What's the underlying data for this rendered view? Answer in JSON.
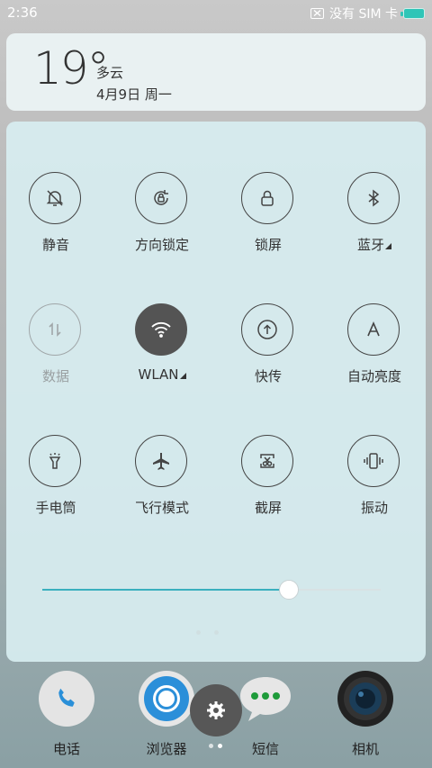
{
  "status_bar": {
    "time": "2:36",
    "sim_text": "没有 SIM 卡"
  },
  "weather": {
    "temp": "19°",
    "condition": "多云",
    "date": "4月9日 周一"
  },
  "toggles": [
    {
      "label": "静音",
      "icon": "bell-off-icon",
      "state": "off-outline"
    },
    {
      "label": "方向锁定",
      "icon": "rotation-lock-icon",
      "state": "off-outline"
    },
    {
      "label": "锁屏",
      "icon": "lock-icon",
      "state": "off-outline"
    },
    {
      "label": "蓝牙",
      "icon": "bluetooth-icon",
      "state": "off-outline",
      "expandable": true
    },
    {
      "label": "数据",
      "icon": "mobile-data-icon",
      "state": "disabled"
    },
    {
      "label": "WLAN",
      "icon": "wifi-icon",
      "state": "on",
      "expandable": true
    },
    {
      "label": "快传",
      "icon": "quick-share-icon",
      "state": "off-outline"
    },
    {
      "label": "自动亮度",
      "icon": "auto-brightness-icon",
      "state": "off-outline"
    },
    {
      "label": "手电筒",
      "icon": "flashlight-icon",
      "state": "off-outline"
    },
    {
      "label": "飞行模式",
      "icon": "airplane-icon",
      "state": "off-outline"
    },
    {
      "label": "截屏",
      "icon": "screenshot-icon",
      "state": "off-outline"
    },
    {
      "label": "振动",
      "icon": "vibrate-icon",
      "state": "off-outline"
    }
  ],
  "brightness": {
    "level": 0.73
  },
  "dock": [
    {
      "label": "电话",
      "icon": "phone-icon"
    },
    {
      "label": "浏览器",
      "icon": "browser-icon"
    },
    {
      "label": "短信",
      "icon": "messages-icon"
    },
    {
      "label": "相机",
      "icon": "camera-icon"
    }
  ],
  "colors": {
    "accent": "#3ab0be",
    "active_toggle": "#545454",
    "battery": "#2ec5b7"
  }
}
